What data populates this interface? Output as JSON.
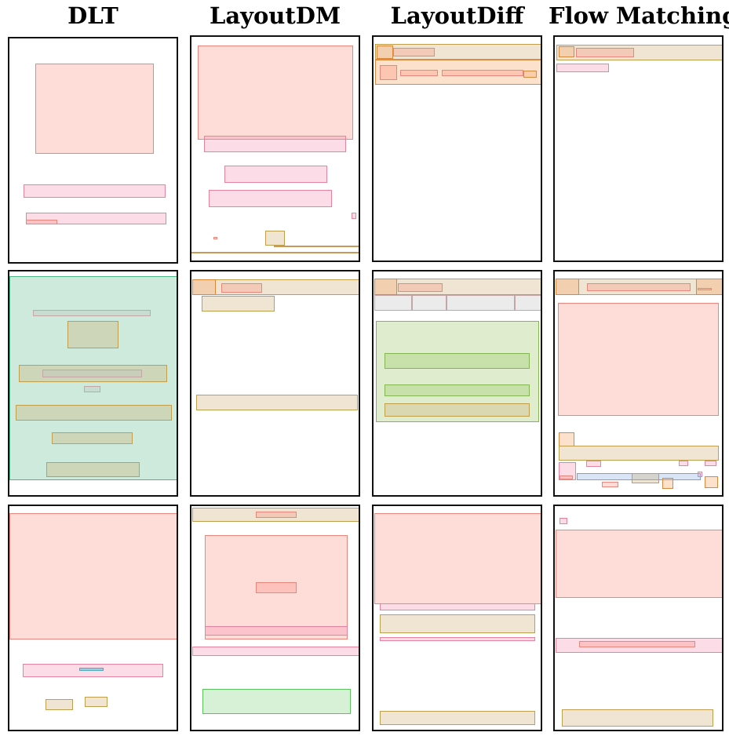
{
  "columns": [
    {
      "title": "DLT"
    },
    {
      "title": "LayoutDM"
    },
    {
      "title": "LayoutDiff"
    },
    {
      "title": "Flow Matching"
    }
  ],
  "colors": {
    "text": "#FA8072",
    "pink": "#F48FB1",
    "tan": "#CDAA6E",
    "orange": "#F5AA6E",
    "green": "#8CBE50",
    "teal": "#50B482",
    "blue": "#82AAE6",
    "cyan": "#6EBED2",
    "light_green": "#78D278"
  }
}
